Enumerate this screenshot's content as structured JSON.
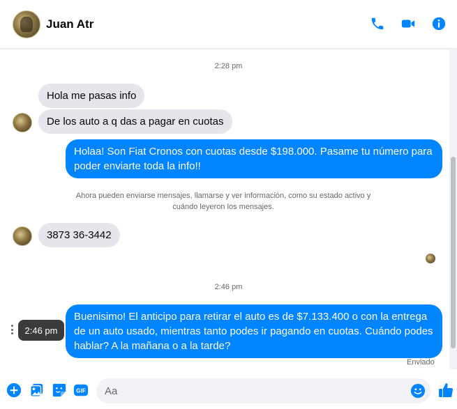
{
  "header": {
    "contact_name": "Juan Atr",
    "icons": [
      "phone-icon",
      "video-camera-icon",
      "info-icon"
    ],
    "accent_color": "#0084ff"
  },
  "thread": {
    "separator_1": "2:28 pm",
    "incoming_1": "Hola me pasas info",
    "incoming_2": "De los auto a q das a pagar en cuotas",
    "outgoing_1": "Holaa! Son Fiat Cronos con cuotas desde $198.000. Pasame tu número para poder enviarte toda la info!!",
    "system_note": "Ahora pueden enviarse mensajes, llamarse y ver información, como su estado activo y cuándo leyeron los mensajes.",
    "incoming_3": "3873 36-3442",
    "separator_2": "2:46 pm",
    "outgoing_2": "Buenisimo! El anticipo para retirar el auto es de $7.133.400 o con la entrega de un auto usado, mientras tanto podes ir pagando en cuotas. Cuándo podes hablar? A la mañana o a la tarde?",
    "tooltip_time": "2:46 pm",
    "status": "Enviado"
  },
  "composer": {
    "placeholder": "Aa",
    "value": "",
    "icons": [
      "plus-icon",
      "photo-icon",
      "sticker-icon",
      "gif-icon",
      "emoji-icon",
      "thumbs-up-icon"
    ]
  }
}
